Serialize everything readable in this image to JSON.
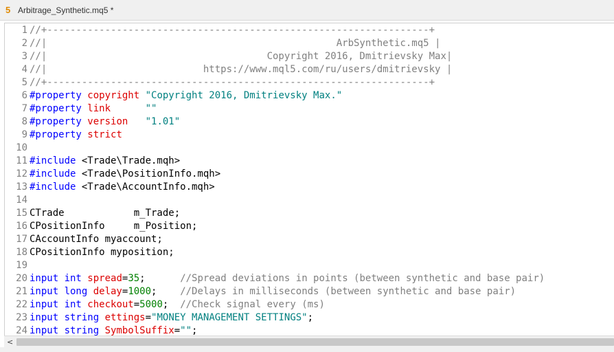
{
  "window": {
    "icon_glyph": "5",
    "title": "Arbitrage_Synthetic.mq5 *"
  },
  "colors": {
    "comment": "#808080",
    "keyword": "#0000ff",
    "property": "#dc0000",
    "string": "#008080",
    "number": "#008000"
  },
  "editor": {
    "lines": [
      {
        "n": "1",
        "tokens": [
          {
            "t": "c",
            "v": "//+------------------------------------------------------------------+"
          }
        ]
      },
      {
        "n": "2",
        "tokens": [
          {
            "t": "c",
            "v": "//|                                                  ArbSynthetic.mq5 |"
          }
        ]
      },
      {
        "n": "3",
        "tokens": [
          {
            "t": "c",
            "v": "//|                                      Copyright 2016, Dmitrievsky Max|"
          }
        ]
      },
      {
        "n": "4",
        "tokens": [
          {
            "t": "c",
            "v": "//|                           https://www.mql5.com/ru/users/dmitrievsky |"
          }
        ]
      },
      {
        "n": "5",
        "tokens": [
          {
            "t": "c",
            "v": "//+------------------------------------------------------------------+"
          }
        ]
      },
      {
        "n": "6",
        "tokens": [
          {
            "t": "k",
            "v": "#property "
          },
          {
            "t": "p",
            "v": "copyright "
          },
          {
            "t": "s",
            "v": "\"Copyright 2016, Dmitrievsky Max.\""
          }
        ]
      },
      {
        "n": "7",
        "tokens": [
          {
            "t": "k",
            "v": "#property "
          },
          {
            "t": "p",
            "v": "link      "
          },
          {
            "t": "s",
            "v": "\"\""
          }
        ]
      },
      {
        "n": "8",
        "tokens": [
          {
            "t": "k",
            "v": "#property "
          },
          {
            "t": "p",
            "v": "version   "
          },
          {
            "t": "s",
            "v": "\"1.01\""
          }
        ]
      },
      {
        "n": "9",
        "tokens": [
          {
            "t": "k",
            "v": "#property "
          },
          {
            "t": "p",
            "v": "strict"
          }
        ]
      },
      {
        "n": "10",
        "tokens": []
      },
      {
        "n": "11",
        "tokens": [
          {
            "t": "k",
            "v": "#include "
          },
          {
            "t": "x",
            "v": "<Trade\\Trade.mqh>"
          }
        ]
      },
      {
        "n": "12",
        "tokens": [
          {
            "t": "k",
            "v": "#include "
          },
          {
            "t": "x",
            "v": "<Trade\\PositionInfo.mqh>"
          }
        ]
      },
      {
        "n": "13",
        "tokens": [
          {
            "t": "k",
            "v": "#include "
          },
          {
            "t": "x",
            "v": "<Trade\\AccountInfo.mqh>"
          }
        ]
      },
      {
        "n": "14",
        "tokens": []
      },
      {
        "n": "15",
        "tokens": [
          {
            "t": "x",
            "v": "CTrade            m_Trade;"
          }
        ]
      },
      {
        "n": "16",
        "tokens": [
          {
            "t": "x",
            "v": "CPositionInfo     m_Position;"
          }
        ]
      },
      {
        "n": "17",
        "tokens": [
          {
            "t": "x",
            "v": "CAccountInfo myaccount;"
          }
        ]
      },
      {
        "n": "18",
        "tokens": [
          {
            "t": "x",
            "v": "CPositionInfo myposition;"
          }
        ]
      },
      {
        "n": "19",
        "tokens": []
      },
      {
        "n": "20",
        "tokens": [
          {
            "t": "k",
            "v": "input int "
          },
          {
            "t": "p",
            "v": "spread"
          },
          {
            "t": "x",
            "v": "="
          },
          {
            "t": "n",
            "v": "35"
          },
          {
            "t": "x",
            "v": ";      "
          },
          {
            "t": "c",
            "v": "//Spread deviations in points (between synthetic and base pair)"
          }
        ]
      },
      {
        "n": "21",
        "tokens": [
          {
            "t": "k",
            "v": "input long "
          },
          {
            "t": "p",
            "v": "delay"
          },
          {
            "t": "x",
            "v": "="
          },
          {
            "t": "n",
            "v": "1000"
          },
          {
            "t": "x",
            "v": ";    "
          },
          {
            "t": "c",
            "v": "//Delays in milliseconds (between synthetic and base pair)"
          }
        ]
      },
      {
        "n": "22",
        "tokens": [
          {
            "t": "k",
            "v": "input int "
          },
          {
            "t": "p",
            "v": "checkout"
          },
          {
            "t": "x",
            "v": "="
          },
          {
            "t": "n",
            "v": "5000"
          },
          {
            "t": "x",
            "v": ";  "
          },
          {
            "t": "c",
            "v": "//Check signal every (ms)"
          }
        ]
      },
      {
        "n": "23",
        "tokens": [
          {
            "t": "k",
            "v": "input string "
          },
          {
            "t": "p",
            "v": "ettings"
          },
          {
            "t": "x",
            "v": "="
          },
          {
            "t": "s",
            "v": "\"MONEY MANAGEMENT SETTINGS\""
          },
          {
            "t": "x",
            "v": ";"
          }
        ]
      },
      {
        "n": "24",
        "tokens": [
          {
            "t": "k",
            "v": "input string "
          },
          {
            "t": "p",
            "v": "SymbolSuffix"
          },
          {
            "t": "x",
            "v": "="
          },
          {
            "t": "s",
            "v": "\"\""
          },
          {
            "t": "x",
            "v": ";"
          }
        ]
      }
    ]
  },
  "scrollbar": {
    "left_arrow": "<"
  }
}
